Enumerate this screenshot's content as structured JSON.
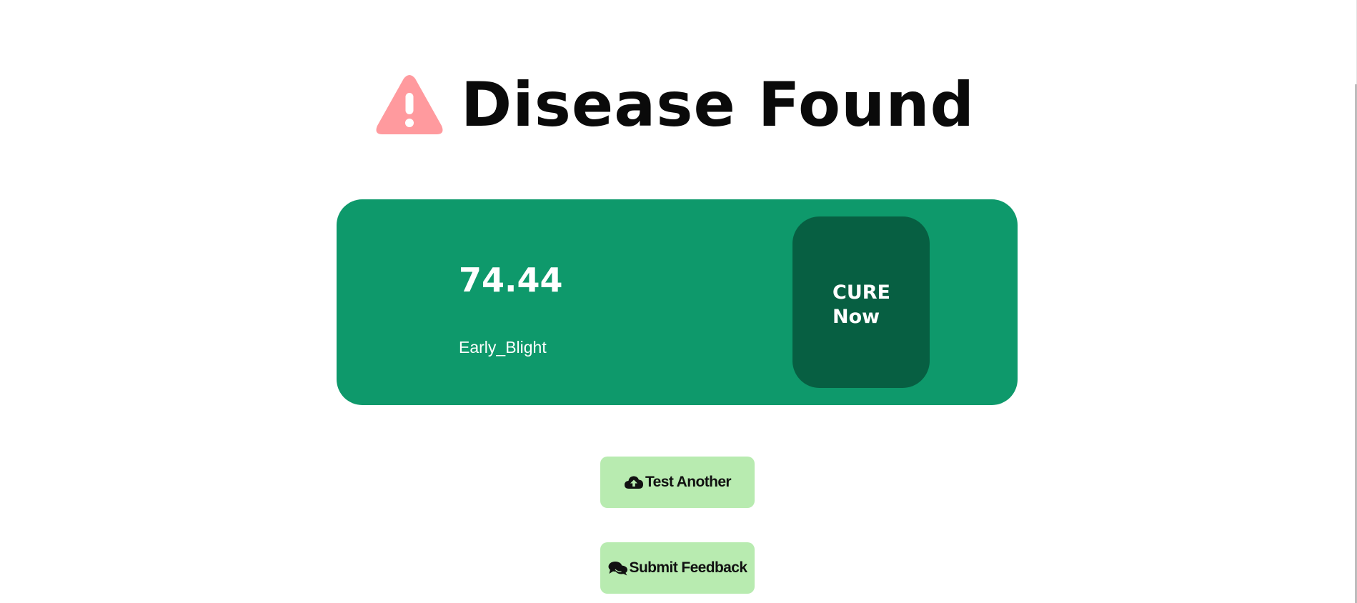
{
  "header": {
    "icon": "warning-triangle-icon",
    "icon_color": "#ff9a9e",
    "title": "Disease Found"
  },
  "result": {
    "confidence": "74.44",
    "disease": "Early_Blight",
    "card_color": "#0e996b",
    "cure_button": {
      "line1": "CURE",
      "line2": "Now",
      "color": "#075f42"
    }
  },
  "actions": {
    "test_another": {
      "icon": "cloud-upload-icon",
      "label": "Test Another"
    },
    "submit_feedback": {
      "icon": "comments-icon",
      "label": "Submit Feedback"
    },
    "button_color": "#b8ebb0"
  }
}
